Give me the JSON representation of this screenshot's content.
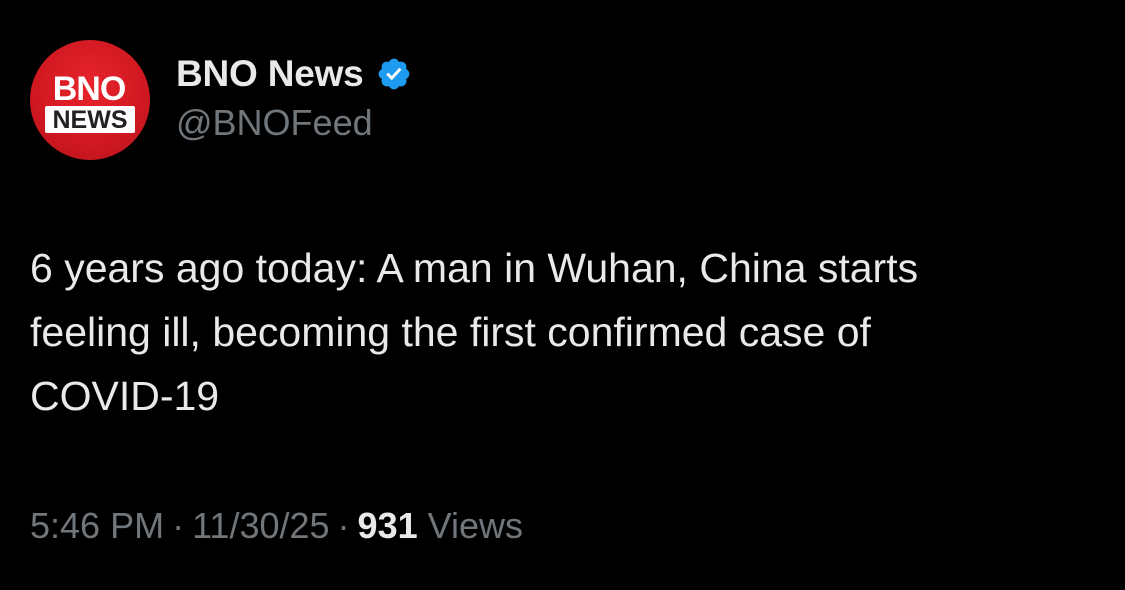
{
  "author": {
    "avatar_text_top": "BNO",
    "avatar_text_bottom": "NEWS",
    "display_name": "BNO News",
    "handle": "@BNOFeed",
    "verified": true,
    "verified_icon": "verified-badge-icon"
  },
  "tweet": {
    "text_lines": [
      "6 years ago today: A man in Wuhan, China starts",
      "feeling ill, becoming the first confirmed case of",
      "COVID-19"
    ]
  },
  "meta": {
    "time": "5:46 PM",
    "separator": "·",
    "date": "11/30/25",
    "views_count": "931",
    "views_label": "Views"
  },
  "colors": {
    "background": "#000000",
    "primary_text": "#e7e9ea",
    "secondary_text": "#71767b",
    "verified_blue": "#1d9bf0",
    "avatar_red": "#d01821"
  }
}
